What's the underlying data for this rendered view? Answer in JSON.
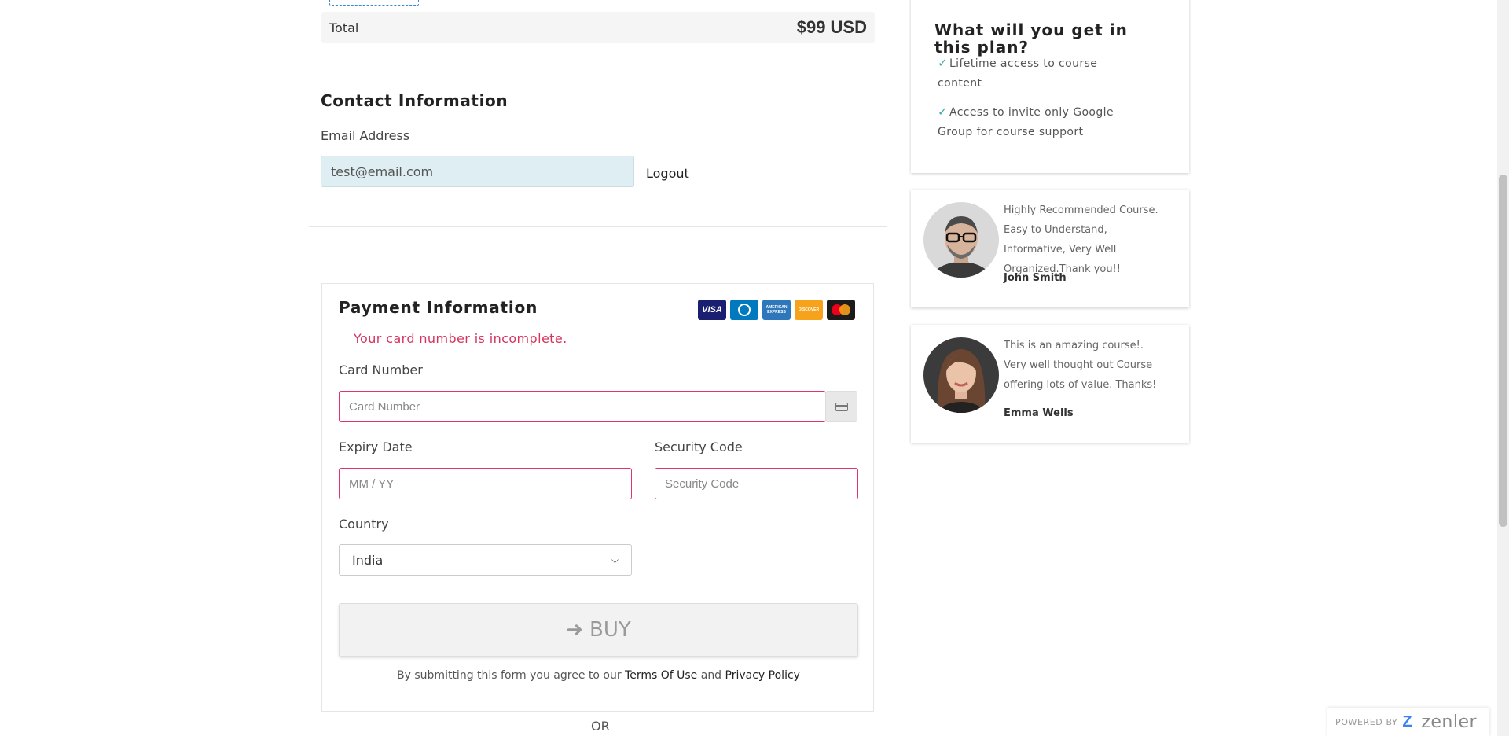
{
  "order": {
    "total_label": "Total",
    "total_value": "$99 USD"
  },
  "contact": {
    "title": "Contact Information",
    "email_label": "Email Address",
    "email_value": "test@email.com",
    "logout_label": "Logout"
  },
  "payment": {
    "title": "Payment Information",
    "cards": [
      "VISA",
      "DINERS",
      "AMERICAN EXPRESS",
      "DISCOVER",
      "MASTERCARD"
    ],
    "error": "Your card number is incomplete.",
    "card_number_label": "Card Number",
    "card_number_placeholder": "Card Number",
    "expiry_label": "Expiry Date",
    "expiry_placeholder": "MM / YY",
    "security_label": "Security Code",
    "security_placeholder": "Security Code",
    "country_label": "Country",
    "country_value": "India",
    "buy_label": "BUY",
    "terms_prefix": "By submitting this form you agree to our",
    "terms_link": "Terms Of Use",
    "terms_and": "and",
    "privacy_link": "Privacy Policy",
    "or_text": "OR"
  },
  "plan": {
    "title": "What will you get in this plan?",
    "items": [
      "Lifetime access to course content",
      "Access to invite only Google Group for course support"
    ]
  },
  "testimonials": [
    {
      "quote": "Highly Recommended Course. Easy to Understand, Informative, Very Well Organized.Thank you!!",
      "author": "John Smith"
    },
    {
      "quote": "This is an amazing course!. Very well thought out Course offering lots of value. Thanks!",
      "author": "Emma Wells"
    }
  ],
  "powered": {
    "label": "POWERED BY",
    "brand": "zenler"
  },
  "colors": {
    "error": "#d6345d",
    "field_border": "#e0336f",
    "check": "#3aaea6",
    "email_bg": "#dfeef2"
  }
}
